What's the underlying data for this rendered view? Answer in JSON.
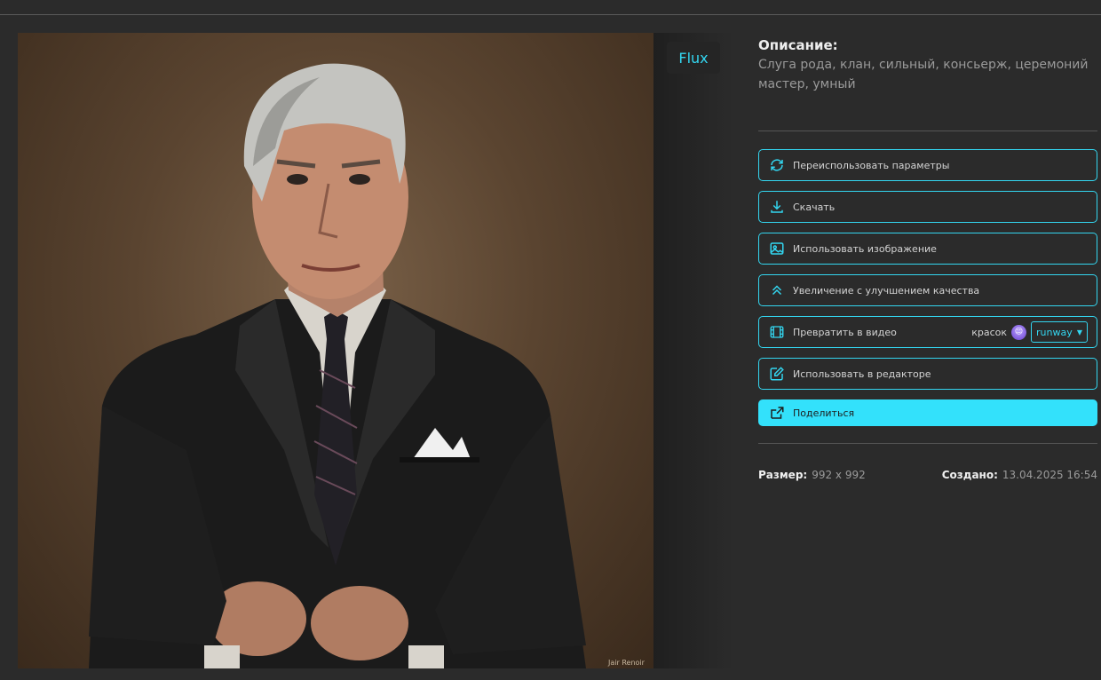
{
  "model_badge": "Flux",
  "description": {
    "label": "Описание:",
    "text": "Слуга рода, клан, сильный, консьерж, церемоний мастер, умный"
  },
  "actions": {
    "reuse_params": "Переиспользовать параметры",
    "download": "Скачать",
    "use_image": "Использовать изображение",
    "upscale": "Увеличение с улучшением качества",
    "to_video": "Превратить в видео",
    "video_cost_label": "красок",
    "video_provider": "runway",
    "use_in_editor": "Использовать в редакторе",
    "share": "Поделиться"
  },
  "meta": {
    "size_label": "Размер:",
    "size_value": "992 x 992",
    "created_label": "Создано:",
    "created_value": "13.04.2025 16:54"
  },
  "image": {
    "subject_icon": "portrait-image",
    "watermark": "Jair Renoir"
  },
  "colors": {
    "accent": "#33d6f0",
    "background": "#2b2b2b",
    "share_fill": "#33e1fb"
  }
}
